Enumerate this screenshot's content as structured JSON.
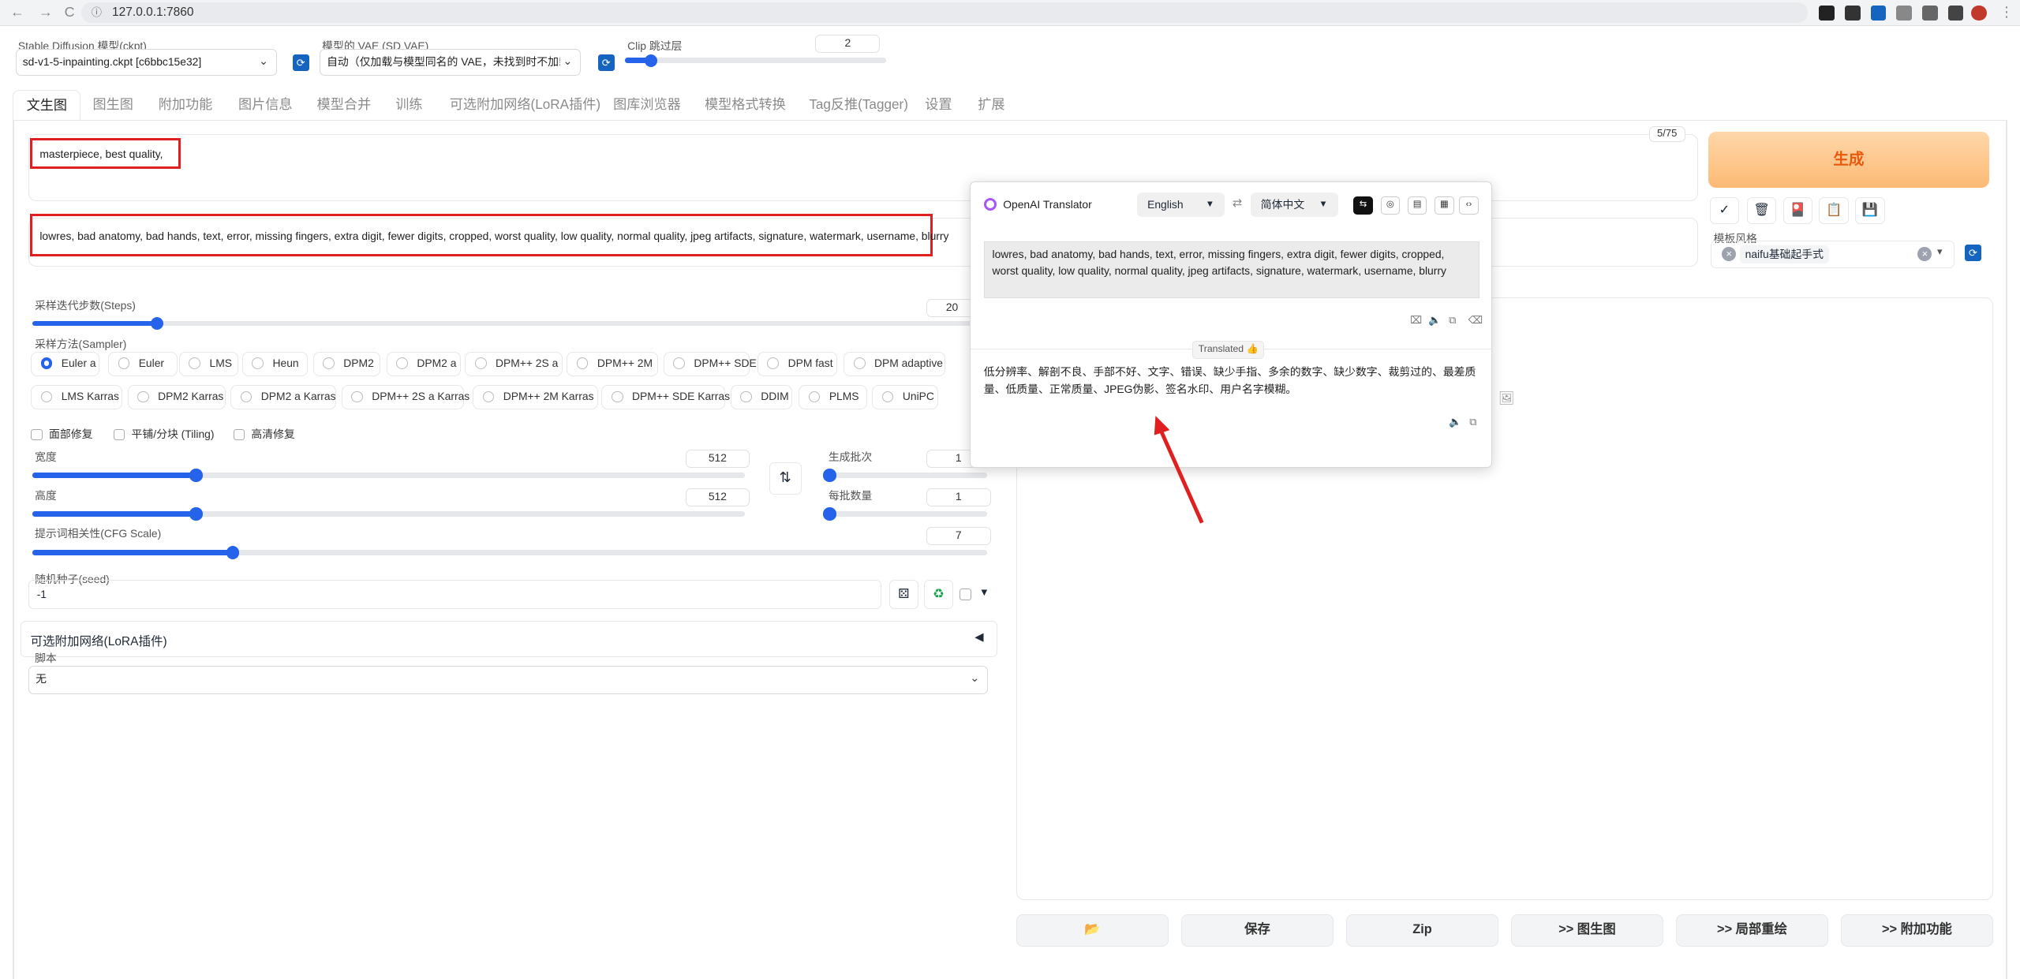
{
  "browser": {
    "url": "127.0.0.1:7860",
    "back": "←",
    "forward": "→",
    "reload": "C"
  },
  "top": {
    "model_label": "Stable Diffusion 模型(ckpt)",
    "model_value": "sd-v1-5-inpainting.ckpt [c6bbc15e32]",
    "vae_label": "模型的 VAE (SD VAE)",
    "vae_value": "自动（仅加载与模型同名的 VAE，未找到时不加载）",
    "clip_label": "Clip 跳过层",
    "clip_value": "2",
    "clip_fraction": 0.1
  },
  "tabs": [
    "文生图",
    "图生图",
    "附加功能",
    "图片信息",
    "模型合并",
    "训练",
    "可选附加网络(LoRA插件)",
    "图库浏览器",
    "模型格式转换",
    "Tag反推(Tagger)",
    "设置",
    "扩展"
  ],
  "prompt": {
    "positive": "masterpiece, best quality,",
    "negative": "lowres, bad anatomy, bad hands, text, error, missing fingers, extra digit, fewer digits, cropped, worst quality, low quality, normal quality, jpeg artifacts, signature, watermark, username, blurry",
    "token_count": "5/75"
  },
  "params": {
    "steps_label": "采样迭代步数(Steps)",
    "steps_value": "20",
    "steps_fraction": 0.13,
    "sampler_label": "采样方法(Sampler)",
    "samplers_row1": [
      "Euler a",
      "Euler",
      "LMS",
      "Heun",
      "DPM2",
      "DPM2 a",
      "DPM++ 2S a",
      "DPM++ 2M",
      "DPM++ SDE",
      "DPM fast",
      "DPM adaptive"
    ],
    "samplers_row2": [
      "LMS Karras",
      "DPM2 Karras",
      "DPM2 a Karras",
      "DPM++ 2S a Karras",
      "DPM++ 2M Karras",
      "DPM++ SDE Karras",
      "DDIM",
      "PLMS",
      "UniPC"
    ],
    "selected_sampler": "Euler a",
    "checks": [
      "面部修复",
      "平铺/分块 (Tiling)",
      "高清修复"
    ],
    "width_label": "宽度",
    "width_value": "512",
    "width_fraction": 0.23,
    "height_label": "高度",
    "height_value": "512",
    "height_fraction": 0.23,
    "batch_count_label": "生成批次",
    "batch_count_value": "1",
    "batch_size_label": "每批数量",
    "batch_size_value": "1",
    "cfg_label": "提示词相关性(CFG Scale)",
    "cfg_value": "7",
    "cfg_fraction": 0.21,
    "seed_label": "随机种子(seed)",
    "seed_value": "-1",
    "lora_label": "可选附加网络(LoRA插件)",
    "script_label": "脚本",
    "script_value": "无"
  },
  "right": {
    "generate": "生成",
    "style_label": "模板风格",
    "style_tag": "naifu基础起手式",
    "buttons": [
      "保存",
      "Zip",
      ">> 图生图",
      ">> 局部重绘",
      ">> 附加功能"
    ]
  },
  "translator": {
    "title": "OpenAI Translator",
    "source_lang": "English",
    "target_lang": "简体中文",
    "source_text": "lowres, bad anatomy, bad hands, text, error, missing fingers, extra digit, fewer digits, cropped, worst quality, low quality, normal quality, jpeg artifacts, signature, watermark, username, blurry",
    "status": "Translated 👍",
    "result_text": "低分辨率、解剖不良、手部不好、文字、错误、缺少手指、多余的数字、缺少数字、裁剪过的、最差质量、低质量、正常质量、JPEG伪影、签名水印、用户名字模糊。"
  },
  "colors": {
    "accent": "#2563eb",
    "annotation": "#e02020",
    "generate_text": "#ea580c"
  }
}
